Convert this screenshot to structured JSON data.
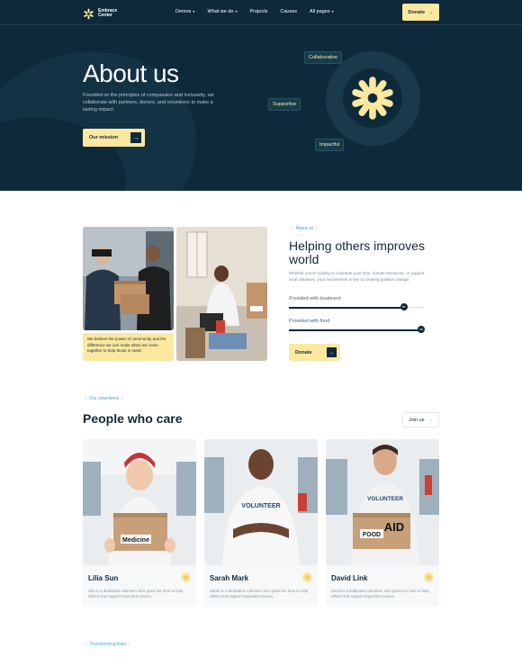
{
  "nav": {
    "logo_text": "Embrace\nCenter",
    "items": [
      {
        "label": "Demos",
        "has_dropdown": true
      },
      {
        "label": "What we do",
        "has_dropdown": true
      },
      {
        "label": "Projects",
        "has_dropdown": false
      },
      {
        "label": "Causes",
        "has_dropdown": false
      },
      {
        "label": "All pages",
        "has_dropdown": true
      }
    ],
    "donate_label": "Donate"
  },
  "hero": {
    "title": "About us",
    "description": "Founded on the principles of compassion and inclusivity, we collaborate with partners, donors, and volunteers to make a lasting impact.",
    "button_label": "Our mission",
    "tags": [
      "Collaborative",
      "Supportive",
      "Impactful"
    ]
  },
  "help": {
    "breadcrumb": "About us",
    "title": "Helping others improves world",
    "description": "Whether you're looking to volunteer your time, donate resources, or support local initiatives, your involvement is key to creating positive change.",
    "quote": "We believe the power of community and the difference we can make when we come together to help those in need.",
    "progress": [
      {
        "label": "Provided with treatment",
        "value": 85,
        "display": "85"
      },
      {
        "label": "Provided with food",
        "value": 98,
        "display": "98"
      }
    ],
    "button_label": "Donate"
  },
  "people": {
    "breadcrumb": "Our volunteers",
    "title": "People who care",
    "join_label": "Join us",
    "cards": [
      {
        "name": "Lilia Sun",
        "description": "Lilia is a dedicated volunteer who gives her time to help others and support important causes.",
        "box_text": "Medicine"
      },
      {
        "name": "Sarah Mark",
        "description": "Sarah is a dedicated volunteer who gives her time to help others and support important causes.",
        "shirt_text": "VOLUNTEER"
      },
      {
        "name": "David Link",
        "description": "David is a dedicated volunteer who gives her time to help others and support important causes.",
        "shirt_text": "VOLUNTEER",
        "box_text_1": "AID",
        "box_text_2": "FOOD"
      }
    ]
  },
  "footer_crumb": "Transforming lives",
  "colors": {
    "navy": "#0e2a3a",
    "accent_yellow": "#fde8a0",
    "accent_blue": "#3aa7d8"
  }
}
